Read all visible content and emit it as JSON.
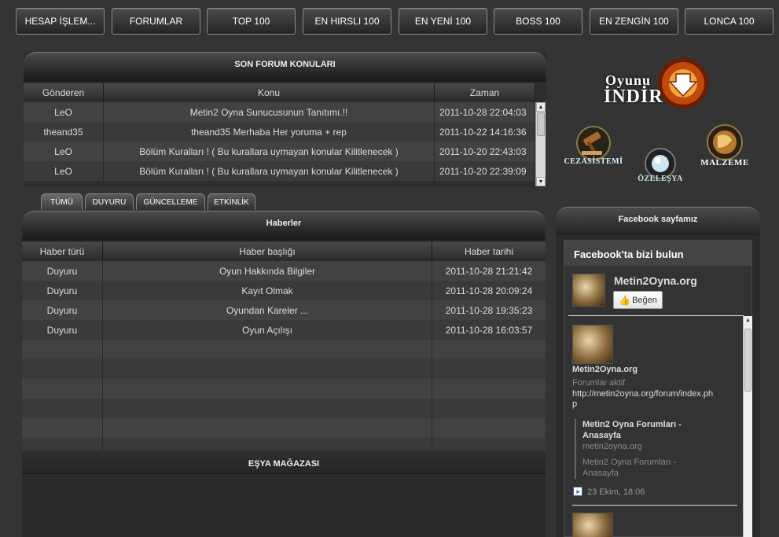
{
  "nav": [
    "HESAP İŞLEM...",
    "FORUMLAR",
    "TOP 100",
    "EN HIRSLI 100",
    "EN YENİ 100",
    "BOSS 100",
    "EN ZENGİN 100",
    "LONCA 100"
  ],
  "forum": {
    "title": "SON FORUM KONULARI",
    "columns": [
      "Gönderen",
      "Konu",
      "Zaman"
    ],
    "rows": [
      [
        "LeO",
        "Metin2 Oyna Sunucusunun Tanıtımı.!!",
        "2011-10-28 22:04:03"
      ],
      [
        "theand35",
        "theand35 Merhaba Her yoruma + rep",
        "2011-10-22 14:16:36"
      ],
      [
        "LeO",
        "Bölüm Kuralları ! ( Bu kurallara uymayan konular Kilitlenecek )",
        "2011-10-20 22:43:03"
      ],
      [
        "LeO",
        "Bölüm Kuralları ! ( Bu kurallara uymayan konular Kilitlenecek )",
        "2011-10-20 22:39:09"
      ]
    ]
  },
  "tabs": [
    "TÜMÜ",
    "DUYURU",
    "GÜNCELLEME",
    "ETKİNLİK"
  ],
  "news": {
    "title": "Haberler",
    "columns": [
      "Haber türü",
      "Haber başlığı",
      "Haber tarihi"
    ],
    "rows": [
      [
        "Duyuru",
        "Oyun Hakkında Bilgiler",
        "2011-10-28 21:21:42"
      ],
      [
        "Duyuru",
        "Kayıt Olmak",
        "2011-10-28 20:09:24"
      ],
      [
        "Duyuru",
        "Oyundan Kareler ...",
        "2011-10-28 19:35:23"
      ],
      [
        "Duyuru",
        "Oyun Açılışı",
        "2011-10-28 16:03:57"
      ]
    ]
  },
  "shop": {
    "title": "EŞYA MAĞAZASI"
  },
  "side": {
    "download_top": "Oyunu",
    "download_bottom": "İNDİR",
    "ceza": "CEZASİSTEMİ",
    "ozel": "ÖZELEŞYA",
    "malzeme": "MALZEME"
  },
  "facebook": {
    "panel_title": "Facebook sayfamız",
    "box_title": "Facebook'ta bizi bulun",
    "page_name": "Metin2Oyna.org",
    "like": "Beğen",
    "post_author": "Metin2Oyna.org",
    "post_text": "Forumlar aktif",
    "post_link": "http://metin2oyna.org/forum/index.php",
    "link_title": "Metin2 Oyna Forumları - Anasayfa",
    "link_domain": "metin2oyna.org",
    "link_desc": "Metin2 Oyna Forumları - Anasayfa",
    "post_date": "23 Ekim, 18:06"
  },
  "colors": {
    "background": "#343434",
    "button_border": "#8a8a8a",
    "row_light": "#424242",
    "row_dark": "#3a3a3a"
  }
}
